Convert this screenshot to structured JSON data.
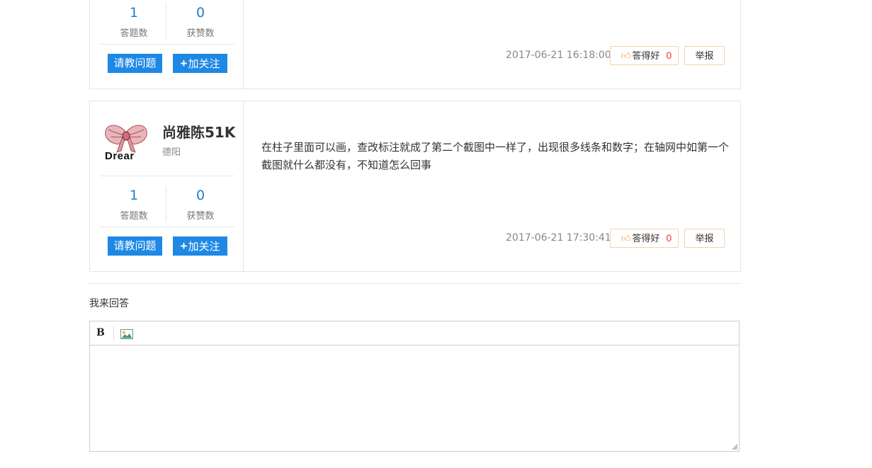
{
  "answers": [
    {
      "username": "",
      "location": "",
      "answers_count": "1",
      "answers_label": "答题数",
      "likes_count": "0",
      "likes_label": "获赞数",
      "ask_button": "请教问题",
      "follow_button": "加关注",
      "content": "",
      "timestamp": "2017-06-21 16:18:00",
      "good_label": "答得好",
      "good_count": "0",
      "report_label": "举报"
    },
    {
      "username": "尚雅陈51K",
      "location": "德阳",
      "avatar_text": "Drear",
      "answers_count": "1",
      "answers_label": "答题数",
      "likes_count": "0",
      "likes_label": "获赞数",
      "ask_button": "请教问题",
      "follow_button": "加关注",
      "content": " 在柱子里面可以画，查改标注就成了第二个截图中一样了，出现很多线条和数字；在轴网中如第一个截图就什么都没有，不知道怎么回事",
      "timestamp": "2017-06-21 17:30:41",
      "good_label": "答得好",
      "good_count": "0",
      "report_label": "举报"
    }
  ],
  "reply_section": {
    "title": "我来回答",
    "bold_tool": "B",
    "image_tool_icon": "image-icon",
    "textarea_value": ""
  },
  "colors": {
    "accent_blue": "#1e88e5",
    "stat_blue": "#1a7fc9",
    "like_red": "#e53935",
    "thumb_orange": "#f39a3c",
    "border": "#e5e5e5"
  }
}
